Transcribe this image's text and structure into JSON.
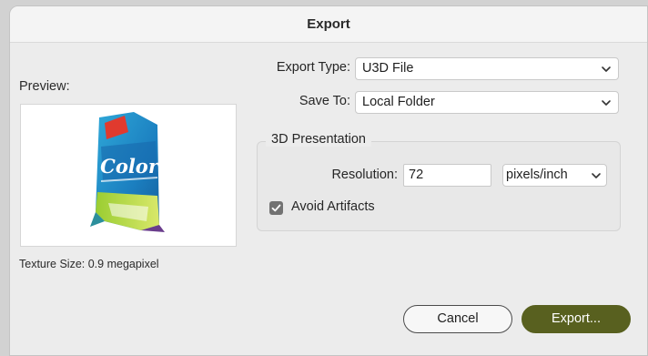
{
  "window": {
    "title": "Export"
  },
  "preview": {
    "label": "Preview:",
    "texture_size": "Texture Size: 0.9 megapixel",
    "package_text": "Color"
  },
  "export_type": {
    "label": "Export Type:",
    "value": "U3D File",
    "icon": "chevron-down-icon"
  },
  "save_to": {
    "label": "Save To:",
    "value": "Local Folder",
    "icon": "chevron-down-icon"
  },
  "presentation": {
    "title": "3D Presentation",
    "resolution_label": "Resolution:",
    "resolution_value": "72",
    "unit_value": "pixels/inch",
    "avoid_artifacts_label": "Avoid Artifacts",
    "avoid_artifacts_checked": true
  },
  "buttons": {
    "cancel": "Cancel",
    "export": "Export..."
  },
  "colors": {
    "accent": "#58601f",
    "checkbox": "#727272"
  }
}
